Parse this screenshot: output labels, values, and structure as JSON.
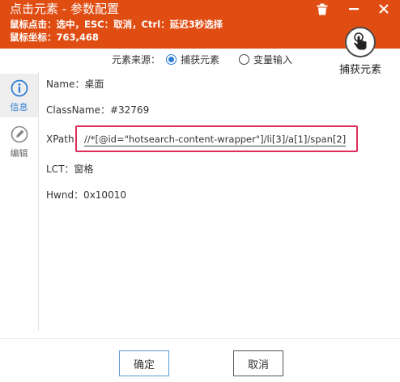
{
  "window": {
    "title": "点击元素 - 参数配置",
    "hint_line1": "鼠标点击：选中，ESC：取消，Ctrl：延迟3秒选择",
    "hint_line2": "鼠标坐标：763,468",
    "buttons": [
      "trash-icon",
      "minimize-icon",
      "close-icon"
    ]
  },
  "source": {
    "label": "元素来源：",
    "options": [
      {
        "label": "捕获元素",
        "checked": true
      },
      {
        "label": "变量输入",
        "checked": false
      }
    ]
  },
  "capture": {
    "label": "捕获元素",
    "icon": "touch-hand-icon"
  },
  "sidebar": {
    "items": [
      {
        "label": "信息",
        "icon": "info-icon",
        "active": true
      },
      {
        "label": "编辑",
        "icon": "edit-icon",
        "active": false
      }
    ]
  },
  "details": {
    "name": "Name：桌面",
    "classname": "ClassName：#32769",
    "xpath_label": "XPath：",
    "xpath_value": "//*[@id=\"hotsearch-content-wrapper\"]/li[3]/a[1]/span[2]",
    "lct": "LCT：窗格",
    "hwnd": "Hwnd：0x10010"
  },
  "footer": {
    "ok_label": "确定",
    "cancel_label": "取消"
  },
  "colors": {
    "titlebar": "#e04d13",
    "accent": "#2a7bd6",
    "highlight_border": "#dd2d5a"
  }
}
